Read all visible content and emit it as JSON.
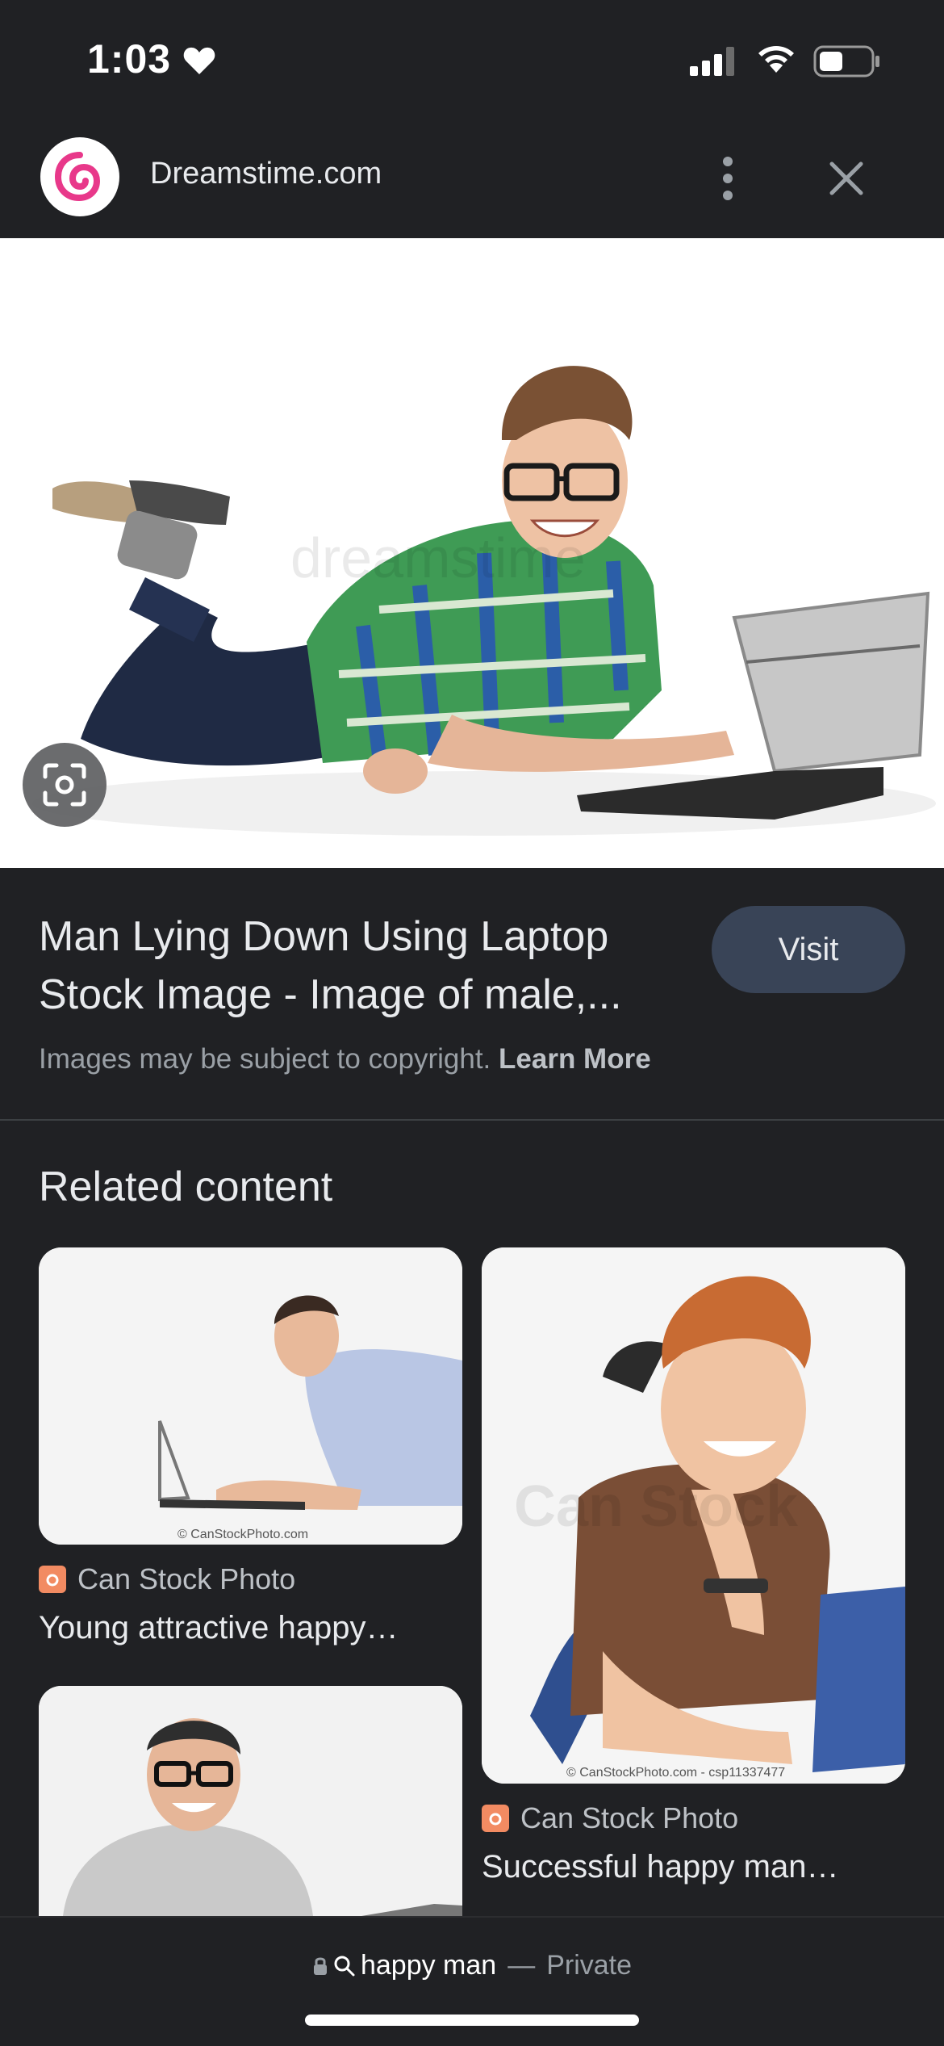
{
  "status_bar": {
    "time": "1:03"
  },
  "header": {
    "site_name": "Dreamstime.com"
  },
  "main_image": {
    "watermark": "dreamstime"
  },
  "result": {
    "title_line1": "Man Lying Down Using Laptop",
    "title_line2": "Stock Image - Image of male,...",
    "visit_label": "Visit",
    "copyright_text": "Images may be subject to copyright.",
    "learn_more": "Learn More"
  },
  "related": {
    "heading": "Related content",
    "items": [
      {
        "source": "Can Stock Photo",
        "title": "Young attractive happy…",
        "image_caption": "© CanStockPhoto.com"
      },
      {
        "source": "Can Stock Photo",
        "title": "Successful happy man…",
        "image_caption": "© CanStockPhoto.com - csp11337477",
        "watermark": "Can Stock"
      }
    ]
  },
  "bottom_bar": {
    "query": "happy man",
    "separator": "—",
    "mode": "Private"
  },
  "colors": {
    "background": "#202124",
    "visit_button": "#394457",
    "logo_pink": "#e8388a",
    "source_icon": "#f28b62"
  }
}
